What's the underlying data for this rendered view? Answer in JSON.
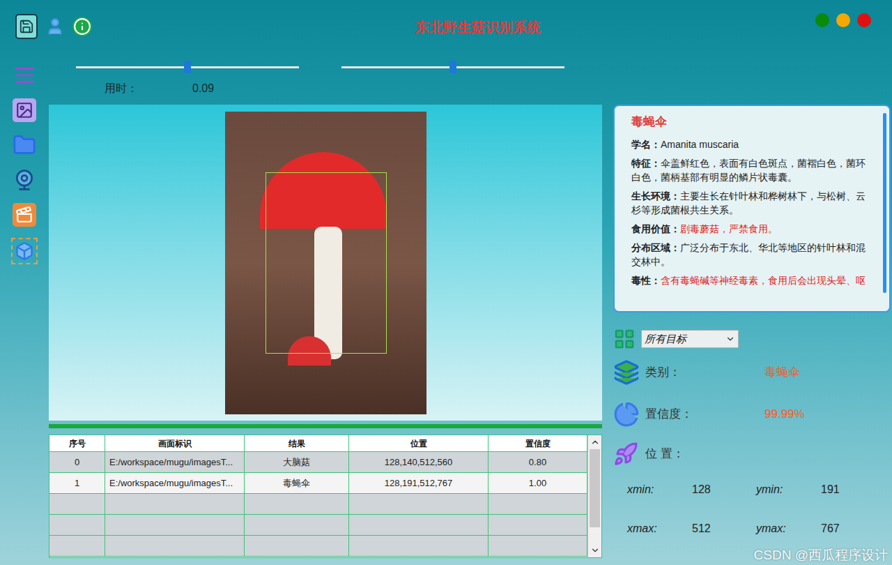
{
  "window": {
    "title": "东北野生菇识别系统"
  },
  "window_controls": [
    {
      "color": "#0a8a0a"
    },
    {
      "color": "#f5a800"
    },
    {
      "color": "#e01010"
    }
  ],
  "sliders": [
    {
      "level": 0.5
    },
    {
      "level": 0.5
    }
  ],
  "timing": {
    "label": "用时：",
    "value": "0.09"
  },
  "table": {
    "columns": [
      "序号",
      "画面标识",
      "结果",
      "位置",
      "置信度"
    ],
    "rows": [
      {
        "cells": [
          "0",
          "E:/workspace/mugu/imagesT...",
          "大脑菇",
          "128,140,512,560",
          "0.80"
        ],
        "selected": false
      },
      {
        "cells": [
          "1",
          "E:/workspace/mugu/imagesT...",
          "毒蝇伞",
          "128,191,512,767",
          "1.00"
        ],
        "selected": true
      },
      {
        "cells": [
          "",
          "",
          "",
          "",
          ""
        ],
        "selected": false
      },
      {
        "cells": [
          "",
          "",
          "",
          "",
          ""
        ],
        "selected": false
      },
      {
        "cells": [
          "",
          "",
          "",
          "",
          ""
        ],
        "selected": false
      }
    ]
  },
  "info": {
    "title": "毒蝇伞",
    "sections": [
      {
        "label": "学名：",
        "text": "Amanita muscaria",
        "kind": "normal"
      },
      {
        "label": "特征：",
        "text": "伞盖鲜红色，表面有白色斑点，菌褶白色，菌环白色，菌柄基部有明显的鳞片状毒囊。",
        "kind": "normal"
      },
      {
        "label": "生长环境：",
        "text": "主要生长在针叶林和桦树林下，与松树、云杉等形成菌根共生关系。",
        "kind": "normal"
      },
      {
        "label": "食用价值：",
        "text": "剧毒蘑菇，严禁食用。",
        "kind": "warning"
      },
      {
        "label": "分布区域：",
        "text": "广泛分布于东北、华北等地区的针叶林和混交林中。",
        "kind": "normal"
      },
      {
        "label": "毒性：",
        "text": "含有毒蝇碱等神经毒素，食用后会出现头晕、呕",
        "kind": "warning"
      }
    ]
  },
  "filter": {
    "value": "所有目标"
  },
  "result": {
    "category": {
      "label": "类别：",
      "value": "毒蝇伞"
    },
    "confidence": {
      "label": "置信度：",
      "value": "99.99%"
    },
    "position": {
      "label": "位 置：",
      "coords": [
        {
          "label": "xmin:",
          "value": "128"
        },
        {
          "label": "ymin:",
          "value": "191"
        },
        {
          "label": "xmax:",
          "value": "512"
        },
        {
          "label": "ymax:",
          "value": "767"
        }
      ]
    }
  },
  "watermark": "CSDN @西瓜程序设计"
}
